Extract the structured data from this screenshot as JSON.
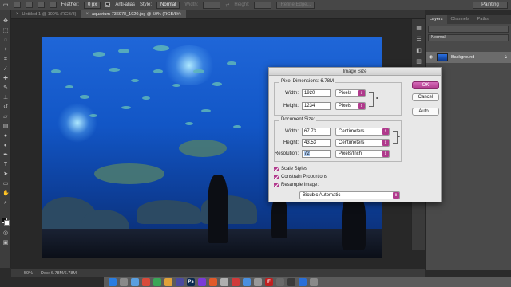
{
  "options_bar": {
    "feather_label": "Feather:",
    "feather_value": "0 px",
    "antialias_label": "Anti-alias",
    "style_label": "Style:",
    "style_value": "Normal",
    "width_label": "Width:",
    "height_label": "Height:",
    "refine_edge": "Refine Edge...",
    "workspace": "Painting"
  },
  "tabs": [
    {
      "label": "Untitled-1 @ 100% (RGB/8)"
    },
    {
      "label": "aquarium-736978_1920.jpg @ 50% (RGB/8#)"
    }
  ],
  "status": {
    "zoom": "50%",
    "doc_info": "Doc: 6.78M/6.78M"
  },
  "layers_panel": {
    "tabs": [
      "Layers",
      "Channels",
      "Paths"
    ],
    "mode": "Normal",
    "layer_name": "Background"
  },
  "dialog": {
    "title": "Image Size",
    "pixel_dimensions": {
      "title": "Pixel Dimensions:",
      "value": "6.78M",
      "width_label": "Width:",
      "width": "1920",
      "width_unit": "Pixels",
      "height_label": "Height:",
      "height": "1234",
      "height_unit": "Pixels"
    },
    "document_size": {
      "title": "Document Size:",
      "width_label": "Width:",
      "width": "67.73",
      "width_unit": "Centimeters",
      "height_label": "Height:",
      "height": "43.53",
      "height_unit": "Centimeters",
      "resolution_label": "Resolution:",
      "resolution": "72",
      "resolution_unit": "Pixels/Inch"
    },
    "checkboxes": {
      "scale_styles": "Scale Styles",
      "constrain": "Constrain Proportions",
      "resample": "Resample Image:"
    },
    "resample_method": "Bicubic Automatic",
    "buttons": {
      "ok": "OK",
      "cancel": "Cancel",
      "auto": "Auto..."
    }
  },
  "colors": {
    "accent": "#b03a8c",
    "dialog_bg": "#e8e8e8",
    "ui_dark": "#2b2b2b"
  },
  "dock_icons": [
    {
      "name": "safari-icon",
      "color": "#2a7de1",
      "glyph": ""
    },
    {
      "name": "launchpad-icon",
      "color": "#8a8a8a",
      "glyph": ""
    },
    {
      "name": "mail-icon",
      "color": "#5a9fe0",
      "glyph": ""
    },
    {
      "name": "app-icon",
      "color": "#d84a3a",
      "glyph": ""
    },
    {
      "name": "chrome-icon",
      "color": "#3aa757",
      "glyph": ""
    },
    {
      "name": "photos-icon",
      "color": "#e0a23a",
      "glyph": ""
    },
    {
      "name": "app-icon",
      "color": "#4a4aa0",
      "glyph": ""
    },
    {
      "name": "photoshop-icon",
      "color": "#0b2a4f",
      "glyph": "Ps"
    },
    {
      "name": "app-icon",
      "color": "#7a3ad8",
      "glyph": ""
    },
    {
      "name": "app-icon",
      "color": "#e05a2a",
      "glyph": ""
    },
    {
      "name": "app-icon",
      "color": "#b0b0b0",
      "glyph": ""
    },
    {
      "name": "app-icon",
      "color": "#d03a3a",
      "glyph": ""
    },
    {
      "name": "app-icon",
      "color": "#4a90e0",
      "glyph": ""
    },
    {
      "name": "app-icon",
      "color": "#999999",
      "glyph": ""
    },
    {
      "name": "filezilla-icon",
      "color": "#c02020",
      "glyph": "F"
    },
    {
      "name": "app-icon",
      "color": "#6a6a6a",
      "glyph": ""
    },
    {
      "name": "app-icon",
      "color": "#3a3a3a",
      "glyph": ""
    },
    {
      "name": "app-icon",
      "color": "#2a6fd8",
      "glyph": ""
    },
    {
      "name": "trash-icon",
      "color": "#8a8a8a",
      "glyph": ""
    }
  ]
}
